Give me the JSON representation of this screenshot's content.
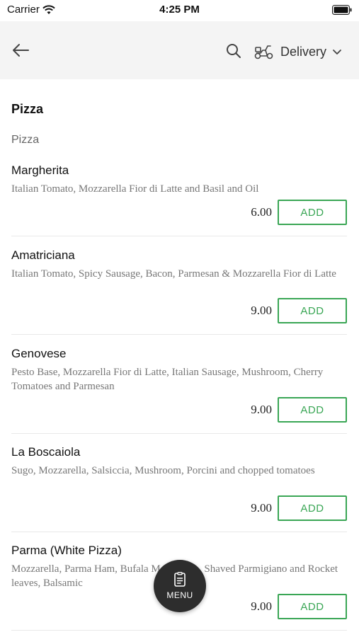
{
  "status_bar": {
    "carrier": "Carrier",
    "time": "4:25 PM"
  },
  "header": {
    "back_icon": "arrow-left-icon",
    "search_icon": "search-icon",
    "delivery_icon": "scooter-icon",
    "delivery_label": "Delivery",
    "chevron_icon": "chevron-down-icon"
  },
  "menu": {
    "section_title": "Pizza",
    "subsection_title": "Pizza",
    "items": [
      {
        "name": "Margherita",
        "description": "Italian Tomato, Mozzarella Fior di Latte and Basil and Oil",
        "price": "6.00",
        "add_label": "ADD"
      },
      {
        "name": "Amatriciana",
        "description": "Italian Tomato, Spicy Sausage, Bacon, Parmesan & Mozzarella Fior di Latte",
        "price": "9.00",
        "add_label": "ADD"
      },
      {
        "name": "Genovese",
        "description": "Pesto Base, Mozzarella Fior di Latte, Italian Sausage, Mushroom, Cherry Tomatoes and Parmesan",
        "price": "9.00",
        "add_label": "ADD"
      },
      {
        "name": "La Boscaiola",
        "description": "Sugo, Mozzarella, Salsiccia, Mushroom, Porcini and chopped tomatoes",
        "price": "9.00",
        "add_label": "ADD"
      },
      {
        "name": "Parma (White Pizza)",
        "description": "Mozzarella, Parma Ham, Bufala Mozzarella, Shaved Parmigiano and Rocket leaves, Balsamic",
        "price": "9.00",
        "add_label": "ADD"
      }
    ]
  },
  "menu_button": {
    "icon": "menu-book-icon",
    "label": "MENU"
  },
  "colors": {
    "accent": "#3aa655",
    "header_bg": "#f4f4f4",
    "fab_bg": "#2d2d2d"
  }
}
